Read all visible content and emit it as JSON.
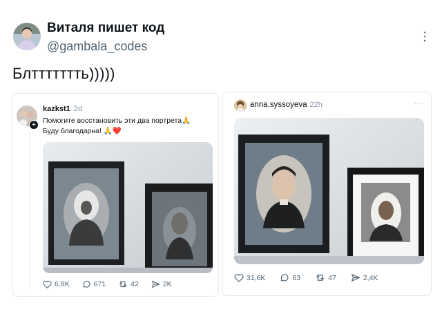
{
  "author": {
    "name": "Виталя пишет код",
    "handle": "@gambala_codes",
    "avatar_icon": "person-avatar"
  },
  "post": {
    "text": "Блттттттть)))))"
  },
  "left_card": {
    "username": "kazkst1",
    "time": "2d",
    "text_line1": "Помогите восстановить эти два портрета",
    "text_line1_emoji": "🙏",
    "text_line2": "Буду благодарна!",
    "text_line2_emoji": "🙏❤️",
    "stats": {
      "likes": "6,8K",
      "comments": "671",
      "reposts": "42",
      "shares": "2K"
    }
  },
  "right_card": {
    "username": "anna.syssoyeva",
    "time": "22h",
    "more": "···",
    "stats": {
      "likes": "31,6K",
      "comments": "63",
      "reposts": "47",
      "shares": "2,4K"
    }
  },
  "colors": {
    "text": "#0f1419",
    "secondary": "#536471",
    "border": "#e3e7ea"
  }
}
